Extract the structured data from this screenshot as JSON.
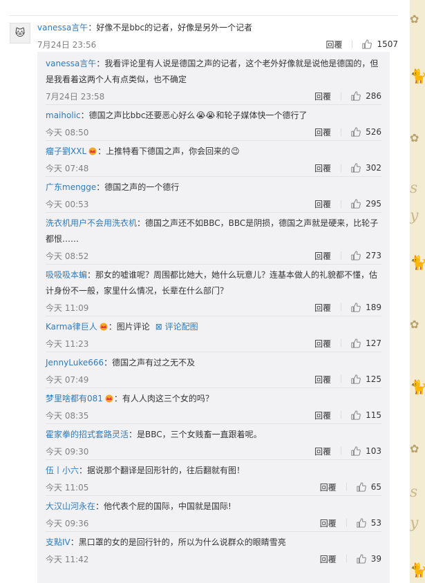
{
  "main": {
    "avatar_glyph": "🐱",
    "user": "vanessa言午",
    "text": "：好像不是bbc的记者，好像是另外一个记者",
    "time": "7月24日 23:56",
    "reply_label": "回覆",
    "likes": "1507"
  },
  "replies": [
    {
      "user": "vanessa言午",
      "text": "：我看评论里有人说是德国之声的记者，这个老外好像就是说他是德国的，但是我看着这两个人有点类似，也不确定",
      "time": "7月24日 23:58",
      "reply_label": "回覆",
      "likes": "286"
    },
    {
      "user": "maiholic",
      "text": "：德国之声比bbc还要恶心好么",
      "emoji": "😭😭",
      "text2": "和轮子媒体快一个德行了",
      "time": "今天 08:50",
      "reply_label": "回覆",
      "likes": "526"
    },
    {
      "user": "瘤子劉XXL",
      "crown": true,
      "text": "：上推特看下德国之声，你会回来的",
      "emoji": "😉",
      "time": "今天 07:48",
      "reply_label": "回覆",
      "likes": "302"
    },
    {
      "user": "广东mengge",
      "text": "：德国之声的一个德行",
      "time": "今天 00:53",
      "reply_label": "回覆",
      "likes": "295"
    },
    {
      "user": "洗衣机用户不会用洗衣机",
      "text": "：德国之声还不如BBC，BBC是阴损，德国之声就是硬来，比轮子都恨……",
      "time": "今天 08:52",
      "reply_label": "回覆",
      "likes": "273"
    },
    {
      "user": "吸吸吸本蝙",
      "text": "：那女的嘘谁呢？周围都比她大，她什么玩意儿？连基本做人的礼貌都不懂，估计身份不一般，家里什么情况，长辈在什么部门？",
      "time": "今天 11:09",
      "reply_label": "回覆",
      "likes": "189"
    },
    {
      "user": "Karma律巨人",
      "crown": true,
      "text": "：图片评论",
      "pic_link": "评论配图",
      "time": "今天 11:23",
      "reply_label": "回覆",
      "likes": "127"
    },
    {
      "user": "JennyLuke666",
      "text": "：德国之声有过之无不及",
      "time": "今天 07:49",
      "reply_label": "回覆",
      "likes": "125"
    },
    {
      "user": "梦里啥都有081",
      "crown": true,
      "text": "：有人人肉这三个女的吗？",
      "time": "今天 08:35",
      "reply_label": "回覆",
      "likes": "115"
    },
    {
      "user": "霍家拳的招式套路灵活",
      "text": "：是BBC，三个女贱畜一直跟着呢。",
      "time": "今天 09:30",
      "reply_label": "回覆",
      "likes": "103"
    },
    {
      "user": "伍丨小六",
      "text": "：据说那个翻译是回形针的，往后翻就有图！",
      "time": "今天 11:05",
      "reply_label": "回覆",
      "likes": "65"
    },
    {
      "user": "大汉山河永在",
      "text": "：他代表个屁的国际，中国就是国际!",
      "time": "今天 09:36",
      "reply_label": "回覆",
      "likes": "53"
    },
    {
      "user": "支點IV",
      "text": "：黑口罩的女的是回行针的，所以为什么说群众的眼睛雪亮",
      "time": "今天 11:42",
      "reply_label": "回覆",
      "likes": "39"
    }
  ]
}
